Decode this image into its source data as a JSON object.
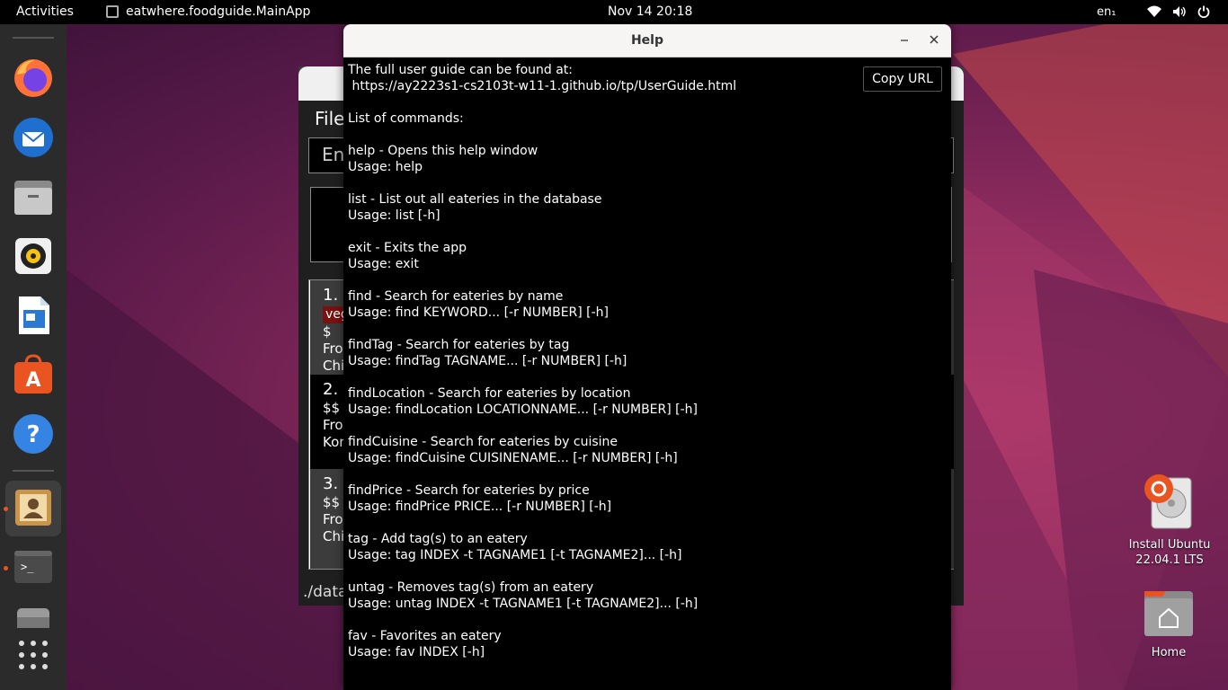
{
  "topbar": {
    "activities": "Activities",
    "app_name": "eatwhere.foodguide.MainApp",
    "clock": "Nov 14  20:18",
    "lang": "en₁",
    "icons": [
      "wifi-icon",
      "volume-icon",
      "power-icon"
    ]
  },
  "dock": {
    "items": [
      "firefox-icon",
      "thunderbird-icon",
      "files-icon",
      "rhythmbox-icon",
      "libreoffice-writer-icon",
      "app-center-icon",
      "help-icon",
      "contacts-app-icon",
      "terminal-icon",
      "drive-icon",
      "show-apps-icon"
    ],
    "accent": "#e95420"
  },
  "desktop": {
    "install": {
      "line1": "Install Ubuntu",
      "line2": "22.04.1 LTS"
    },
    "home": "Home"
  },
  "mainwin": {
    "menu_file": "File",
    "command_placeholder": "En",
    "cards": [
      {
        "index": "1.",
        "tag": "veg",
        "price": "$",
        "loc": "Fro",
        "cuisine": "Chi"
      },
      {
        "index": "2.",
        "price": "$$",
        "loc": "Fro",
        "cuisine": "Kor"
      },
      {
        "index": "3.",
        "price": "$$",
        "loc": "Fro",
        "cuisine": "Chi"
      }
    ],
    "status": "./data"
  },
  "help": {
    "title": "Help",
    "copy_button": "Copy URL",
    "lines": [
      "The full user guide can be found at:",
      " https://ay2223s1-cs2103t-w11-1.github.io/tp/UserGuide.html",
      "",
      "List of commands:",
      "",
      "help - Opens this help window",
      "Usage: help",
      "",
      "list - List out all eateries in the database",
      "Usage: list [-h]",
      "",
      "exit - Exits the app",
      "Usage: exit",
      "",
      "find - Search for eateries by name",
      "Usage: find KEYWORD... [-r NUMBER] [-h]",
      "",
      "findTag - Search for eateries by tag",
      "Usage: findTag TAGNAME... [-r NUMBER] [-h]",
      "",
      "findLocation - Search for eateries by location",
      "Usage: findLocation LOCATIONNAME... [-r NUMBER] [-h]",
      "",
      "findCuisine - Search for eateries by cuisine",
      "Usage: findCuisine CUISINENAME... [-r NUMBER] [-h]",
      "",
      "findPrice - Search for eateries by price",
      "Usage: findPrice PRICE... [-r NUMBER] [-h]",
      "",
      "tag - Add tag(s) to an eatery",
      "Usage: tag INDEX -t TAGNAME1 [-t TAGNAME2]... [-h]",
      "",
      "untag - Removes tag(s) from an eatery",
      "Usage: untag INDEX -t TAGNAME1 [-t TAGNAME2]... [-h]",
      "",
      "fav - Favorites an eatery",
      "Usage: fav INDEX [-h]"
    ]
  }
}
